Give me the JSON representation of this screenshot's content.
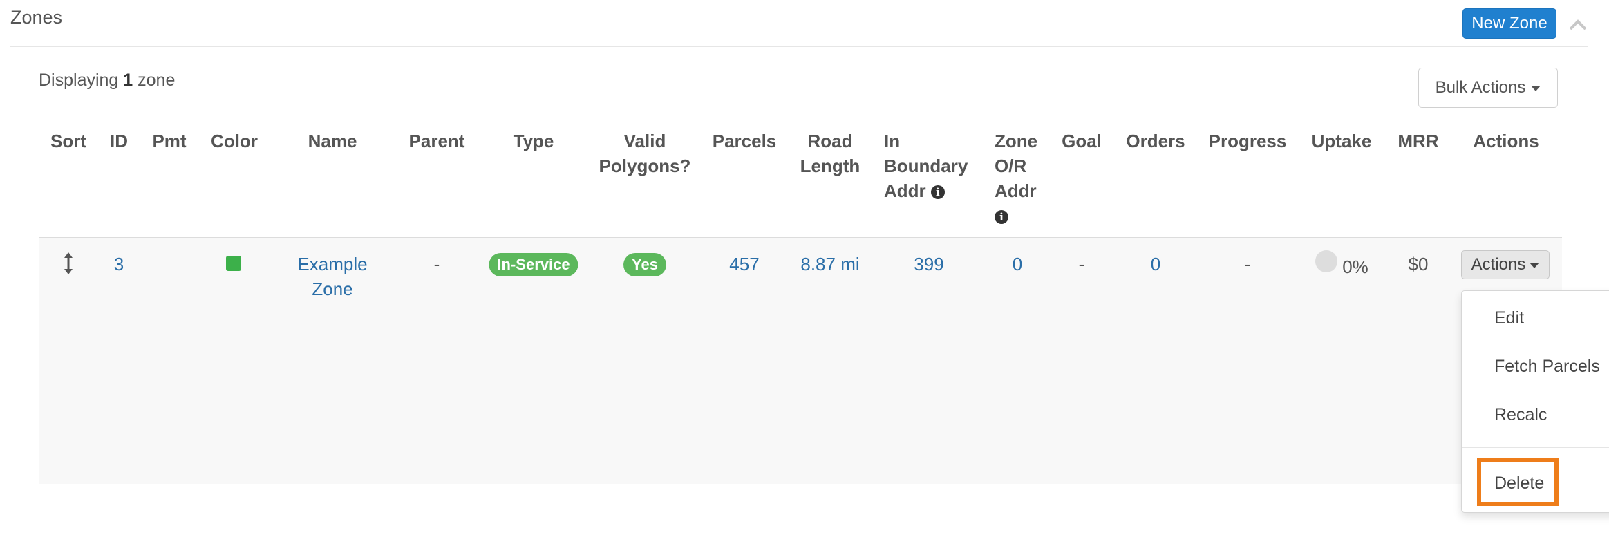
{
  "panel": {
    "title": "Zones",
    "new_zone_label": "New Zone",
    "displaying_prefix": "Displaying",
    "displaying_count": "1",
    "displaying_suffix": "zone",
    "bulk_actions_label": "Bulk Actions"
  },
  "table": {
    "headers": {
      "sort": "Sort",
      "id": "ID",
      "pmt": "Pmt",
      "color": "Color",
      "name": "Name",
      "parent": "Parent",
      "type": "Type",
      "valid_1": "Valid",
      "valid_2": "Polygons?",
      "parcels": "Parcels",
      "road_1": "Road",
      "road_2": "Length",
      "inb_1": "In",
      "inb_2": "Boundary",
      "inb_3": "Addr",
      "zone_1": "Zone",
      "zone_2": "O/R",
      "zone_3": "Addr",
      "goal": "Goal",
      "orders": "Orders",
      "progress": "Progress",
      "uptake": "Uptake",
      "mrr": "MRR",
      "actions": "Actions"
    },
    "row": {
      "id": "3",
      "color": "#3cb04a",
      "name_1": "Example",
      "name_2": "Zone",
      "parent": "-",
      "type": "In-Service",
      "valid": "Yes",
      "parcels": "457",
      "road_length": "8.87 mi",
      "in_boundary": "399",
      "zone_or": "0",
      "goal": "-",
      "orders": "0",
      "progress": "-",
      "uptake": "0%",
      "mrr": "$0",
      "actions_label": "Actions"
    }
  },
  "dropdown": {
    "items": [
      "Edit",
      "Fetch Parcels",
      "Recalc",
      "Delete"
    ]
  },
  "colors": {
    "primary": "#2080cf",
    "link": "#2a6ea8",
    "success": "#5cb85c",
    "highlight": "#ee7d1a"
  }
}
